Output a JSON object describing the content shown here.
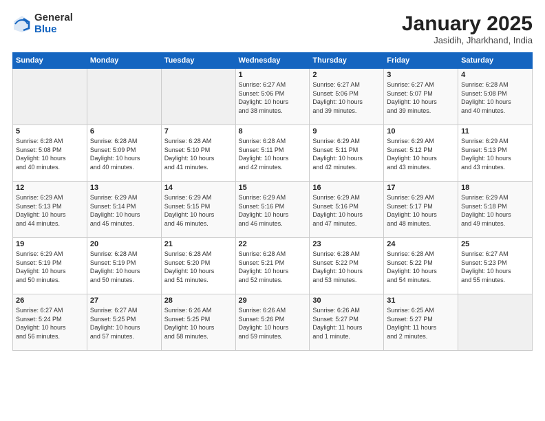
{
  "logo": {
    "general": "General",
    "blue": "Blue"
  },
  "header": {
    "title": "January 2025",
    "subtitle": "Jasidih, Jharkhand, India"
  },
  "weekdays": [
    "Sunday",
    "Monday",
    "Tuesday",
    "Wednesday",
    "Thursday",
    "Friday",
    "Saturday"
  ],
  "weeks": [
    [
      {
        "day": "",
        "info": ""
      },
      {
        "day": "",
        "info": ""
      },
      {
        "day": "",
        "info": ""
      },
      {
        "day": "1",
        "info": "Sunrise: 6:27 AM\nSunset: 5:06 PM\nDaylight: 10 hours\nand 38 minutes."
      },
      {
        "day": "2",
        "info": "Sunrise: 6:27 AM\nSunset: 5:06 PM\nDaylight: 10 hours\nand 39 minutes."
      },
      {
        "day": "3",
        "info": "Sunrise: 6:27 AM\nSunset: 5:07 PM\nDaylight: 10 hours\nand 39 minutes."
      },
      {
        "day": "4",
        "info": "Sunrise: 6:28 AM\nSunset: 5:08 PM\nDaylight: 10 hours\nand 40 minutes."
      }
    ],
    [
      {
        "day": "5",
        "info": "Sunrise: 6:28 AM\nSunset: 5:08 PM\nDaylight: 10 hours\nand 40 minutes."
      },
      {
        "day": "6",
        "info": "Sunrise: 6:28 AM\nSunset: 5:09 PM\nDaylight: 10 hours\nand 40 minutes."
      },
      {
        "day": "7",
        "info": "Sunrise: 6:28 AM\nSunset: 5:10 PM\nDaylight: 10 hours\nand 41 minutes."
      },
      {
        "day": "8",
        "info": "Sunrise: 6:28 AM\nSunset: 5:11 PM\nDaylight: 10 hours\nand 42 minutes."
      },
      {
        "day": "9",
        "info": "Sunrise: 6:29 AM\nSunset: 5:11 PM\nDaylight: 10 hours\nand 42 minutes."
      },
      {
        "day": "10",
        "info": "Sunrise: 6:29 AM\nSunset: 5:12 PM\nDaylight: 10 hours\nand 43 minutes."
      },
      {
        "day": "11",
        "info": "Sunrise: 6:29 AM\nSunset: 5:13 PM\nDaylight: 10 hours\nand 43 minutes."
      }
    ],
    [
      {
        "day": "12",
        "info": "Sunrise: 6:29 AM\nSunset: 5:13 PM\nDaylight: 10 hours\nand 44 minutes."
      },
      {
        "day": "13",
        "info": "Sunrise: 6:29 AM\nSunset: 5:14 PM\nDaylight: 10 hours\nand 45 minutes."
      },
      {
        "day": "14",
        "info": "Sunrise: 6:29 AM\nSunset: 5:15 PM\nDaylight: 10 hours\nand 46 minutes."
      },
      {
        "day": "15",
        "info": "Sunrise: 6:29 AM\nSunset: 5:16 PM\nDaylight: 10 hours\nand 46 minutes."
      },
      {
        "day": "16",
        "info": "Sunrise: 6:29 AM\nSunset: 5:16 PM\nDaylight: 10 hours\nand 47 minutes."
      },
      {
        "day": "17",
        "info": "Sunrise: 6:29 AM\nSunset: 5:17 PM\nDaylight: 10 hours\nand 48 minutes."
      },
      {
        "day": "18",
        "info": "Sunrise: 6:29 AM\nSunset: 5:18 PM\nDaylight: 10 hours\nand 49 minutes."
      }
    ],
    [
      {
        "day": "19",
        "info": "Sunrise: 6:29 AM\nSunset: 5:19 PM\nDaylight: 10 hours\nand 50 minutes."
      },
      {
        "day": "20",
        "info": "Sunrise: 6:28 AM\nSunset: 5:19 PM\nDaylight: 10 hours\nand 50 minutes."
      },
      {
        "day": "21",
        "info": "Sunrise: 6:28 AM\nSunset: 5:20 PM\nDaylight: 10 hours\nand 51 minutes."
      },
      {
        "day": "22",
        "info": "Sunrise: 6:28 AM\nSunset: 5:21 PM\nDaylight: 10 hours\nand 52 minutes."
      },
      {
        "day": "23",
        "info": "Sunrise: 6:28 AM\nSunset: 5:22 PM\nDaylight: 10 hours\nand 53 minutes."
      },
      {
        "day": "24",
        "info": "Sunrise: 6:28 AM\nSunset: 5:22 PM\nDaylight: 10 hours\nand 54 minutes."
      },
      {
        "day": "25",
        "info": "Sunrise: 6:27 AM\nSunset: 5:23 PM\nDaylight: 10 hours\nand 55 minutes."
      }
    ],
    [
      {
        "day": "26",
        "info": "Sunrise: 6:27 AM\nSunset: 5:24 PM\nDaylight: 10 hours\nand 56 minutes."
      },
      {
        "day": "27",
        "info": "Sunrise: 6:27 AM\nSunset: 5:25 PM\nDaylight: 10 hours\nand 57 minutes."
      },
      {
        "day": "28",
        "info": "Sunrise: 6:26 AM\nSunset: 5:25 PM\nDaylight: 10 hours\nand 58 minutes."
      },
      {
        "day": "29",
        "info": "Sunrise: 6:26 AM\nSunset: 5:26 PM\nDaylight: 10 hours\nand 59 minutes."
      },
      {
        "day": "30",
        "info": "Sunrise: 6:26 AM\nSunset: 5:27 PM\nDaylight: 11 hours\nand 1 minute."
      },
      {
        "day": "31",
        "info": "Sunrise: 6:25 AM\nSunset: 5:27 PM\nDaylight: 11 hours\nand 2 minutes."
      },
      {
        "day": "",
        "info": ""
      }
    ]
  ]
}
